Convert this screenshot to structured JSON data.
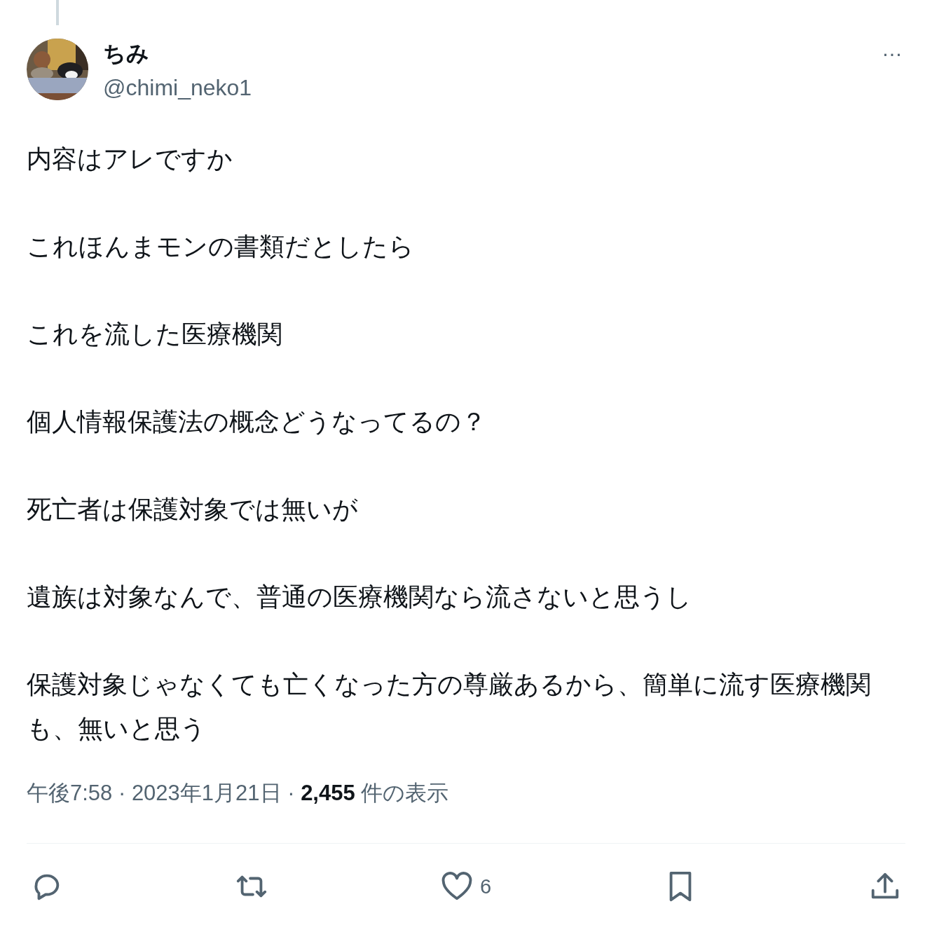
{
  "author": {
    "name": "ちみ",
    "handle": "@chimi_neko1"
  },
  "more": "…",
  "paragraphs": [
    "内容はアレですか",
    "これほんまモンの書類だとしたら",
    "これを流した医療機関",
    "個人情報保護法の概念どうなってるの？",
    "死亡者は保護対象では無いが",
    "遺族は対象なんで、普通の医療機関なら流さないと思うし",
    "保護対象じゃなくても亡くなった方の尊厳あるから、簡単に流す医療機関も、無いと思う"
  ],
  "meta": "午後7:58 · 2023年1月21日 · **2,455** 件の表示",
  "actions": [
    {
      "kind": "reply"
    },
    {
      "kind": "retweet"
    },
    {
      "kind": "like",
      "count": "6"
    },
    {
      "kind": "bookmark"
    },
    {
      "kind": "share"
    }
  ]
}
